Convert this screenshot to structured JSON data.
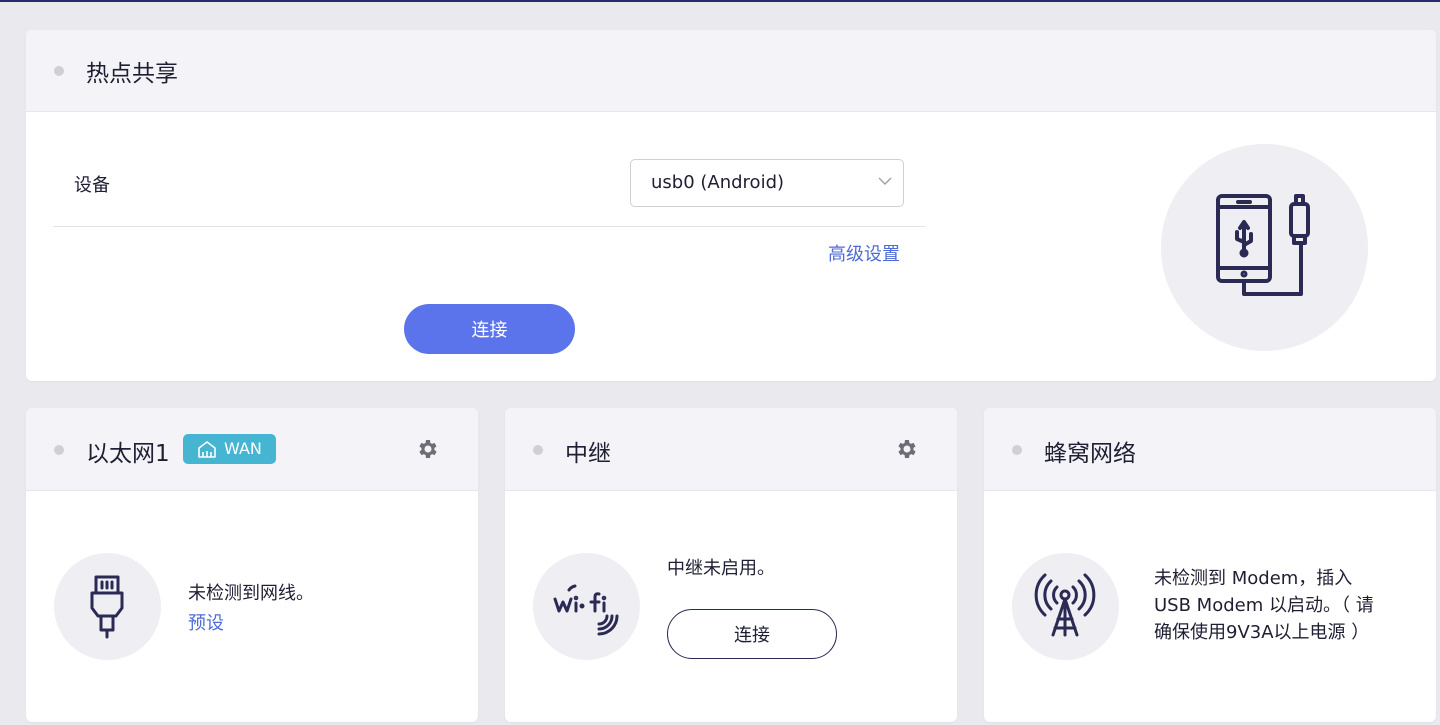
{
  "hotspot": {
    "title": "热点共享",
    "device_label": "设备",
    "device_value": "usb0 (Android)",
    "advanced_link": "高级设置",
    "connect_label": "连接"
  },
  "ethernet": {
    "title": "以太网1",
    "badge": "WAN",
    "status": "未检测到网线。",
    "preset_link": "预设"
  },
  "relay": {
    "title": "中继",
    "status": "中继未启用。",
    "connect_label": "连接"
  },
  "cellular": {
    "title": "蜂窝网络",
    "status_line1": "未检测到 Modem，插入",
    "status_line2": "USB Modem 以启动。（ 请",
    "status_line3": "确保使用9V3A以上电源 ）"
  },
  "icons": {
    "hotspot_illustration": "phone-usb-icon",
    "ethernet": "ethernet-cable-icon",
    "relay": "wifi-icon",
    "cellular": "cell-tower-icon",
    "settings": "gear-icon",
    "wan": "router-icon",
    "dropdown": "chevron-down-icon"
  },
  "colors": {
    "primary": "#5b74ec",
    "link": "#4f6bd8",
    "badge": "#45b5d2",
    "icon_stroke": "#2a2a55"
  }
}
